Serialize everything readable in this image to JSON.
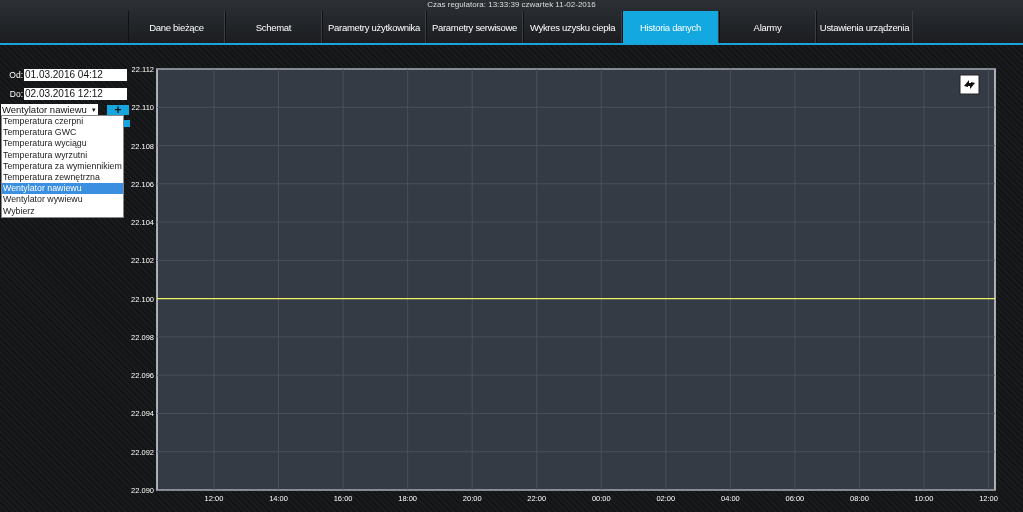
{
  "header": {
    "clock": "Czas regulatora: 13:33:39 czwartek 11-02-2016"
  },
  "tabs": [
    {
      "label": "Dane bieżące",
      "selected": false
    },
    {
      "label": "Schemat",
      "selected": false
    },
    {
      "label": "Parametry użytkownika",
      "selected": false
    },
    {
      "label": "Parametry serwisowe",
      "selected": false
    },
    {
      "label": "Wykres uzysku ciepła",
      "selected": false
    },
    {
      "label": "Historia danych",
      "selected": true
    },
    {
      "label": "Alarmy",
      "selected": false
    },
    {
      "label": "Ustawienia urządzenia",
      "selected": false
    }
  ],
  "filters": {
    "from_label": "Od:",
    "from_value": "01.03.2016 04:12",
    "to_label": "Do:",
    "to_value": "02.03.2016 12:12",
    "series_select": {
      "value": "Wentylator nawiewu",
      "caret": "▾",
      "expanded": true,
      "options": [
        {
          "label": "Temperatura czerpni",
          "selected": false
        },
        {
          "label": "Temperatura GWC",
          "selected": false
        },
        {
          "label": "Temperatura wyciągu",
          "selected": false
        },
        {
          "label": "Temperatura wyrzutni",
          "selected": false
        },
        {
          "label": "Temperatura za wymiennikiem",
          "selected": false
        },
        {
          "label": "Temperatura zewnętrzna",
          "selected": false
        },
        {
          "label": "Wentylator nawiewu",
          "selected": true
        },
        {
          "label": "Wentylator wywiewu",
          "selected": false
        },
        {
          "label": "Wybierz",
          "selected": false
        }
      ]
    },
    "add_button": "+"
  },
  "chart": {
    "chart_data": {
      "type": "line",
      "grid": true,
      "x": [
        "2016-03-01T10:14",
        "2016-03-02T12:12"
      ],
      "series": [
        {
          "color": "#f0f060",
          "values": [
            22.1,
            22.1
          ]
        }
      ],
      "xlim": [
        "2016-03-01T10:14",
        "2016-03-02T12:12"
      ],
      "ylim": [
        22.09,
        22.112
      ],
      "xticks": [
        {
          "value": "2016-03-01T12:00",
          "label": "12:00"
        },
        {
          "value": "2016-03-01T14:00",
          "label": "14:00"
        },
        {
          "value": "2016-03-01T16:00",
          "label": "16:00"
        },
        {
          "value": "2016-03-01T18:00",
          "label": "18:00"
        },
        {
          "value": "2016-03-01T20:00",
          "label": "20:00"
        },
        {
          "value": "2016-03-01T22:00",
          "label": "22:00"
        },
        {
          "value": "2016-03-02T00:00",
          "label": "00:00"
        },
        {
          "value": "2016-03-02T02:00",
          "label": "02:00"
        },
        {
          "value": "2016-03-02T04:00",
          "label": "04:00"
        },
        {
          "value": "2016-03-02T06:00",
          "label": "06:00"
        },
        {
          "value": "2016-03-02T08:00",
          "label": "08:00"
        },
        {
          "value": "2016-03-02T10:00",
          "label": "10:00"
        },
        {
          "value": "2016-03-02T12:00",
          "label": "12:00"
        }
      ],
      "yticks": [
        {
          "value": 22.09,
          "label": "22.090"
        },
        {
          "value": 22.092,
          "label": "22.092"
        },
        {
          "value": 22.094,
          "label": "22.094"
        },
        {
          "value": 22.096,
          "label": "22.096"
        },
        {
          "value": 22.098,
          "label": "22.098"
        },
        {
          "value": 22.1,
          "label": "22.100"
        },
        {
          "value": 22.102,
          "label": "22.102"
        },
        {
          "value": 22.104,
          "label": "22.104"
        },
        {
          "value": 22.106,
          "label": "22.106"
        },
        {
          "value": 22.108,
          "label": "22.108"
        },
        {
          "value": 22.11,
          "label": "22.110"
        },
        {
          "value": 22.112,
          "label": "22.112"
        }
      ]
    }
  }
}
